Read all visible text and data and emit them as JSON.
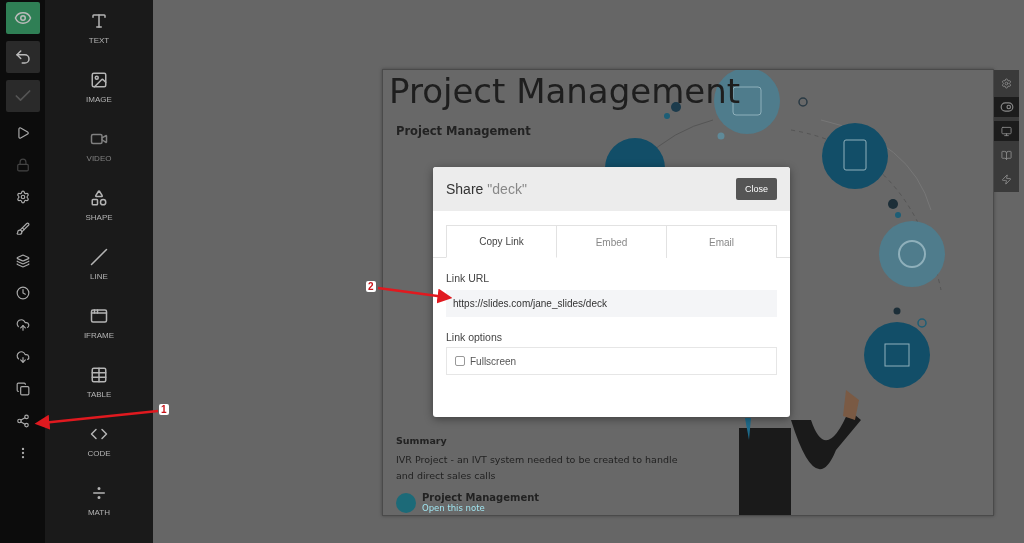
{
  "rail": {
    "preview_on": true
  },
  "tools": [
    {
      "label": "TEXT",
      "disabled": false
    },
    {
      "label": "IMAGE",
      "disabled": false
    },
    {
      "label": "VIDEO",
      "disabled": true
    },
    {
      "label": "SHAPE",
      "disabled": false
    },
    {
      "label": "LINE",
      "disabled": false
    },
    {
      "label": "IFRAME",
      "disabled": false
    },
    {
      "label": "TABLE",
      "disabled": false
    },
    {
      "label": "CODE",
      "disabled": false
    },
    {
      "label": "MATH",
      "disabled": false
    }
  ],
  "slide": {
    "title": "Project Management",
    "note": {
      "heading": "Project Management",
      "summary_label": "Summary",
      "summary": "IVR Project - an IVT system needed to be created to handle and direct sales calls",
      "linked_title": "Project Management",
      "link": "Open this note"
    }
  },
  "dialog": {
    "title": "Share",
    "quoted_name": "\"deck\"",
    "close": "Close",
    "tabs": [
      {
        "label": "Copy Link",
        "selected": true
      },
      {
        "label": "Embed",
        "selected": false
      },
      {
        "label": "Email",
        "selected": false
      }
    ],
    "url_label": "Link URL",
    "url": "https://slides.com/jane_slides/deck",
    "options_label": "Link options",
    "options": [
      {
        "label": "Fullscreen",
        "checked": false
      }
    ]
  },
  "annotations": [
    {
      "label": "1"
    },
    {
      "label": "2"
    }
  ]
}
